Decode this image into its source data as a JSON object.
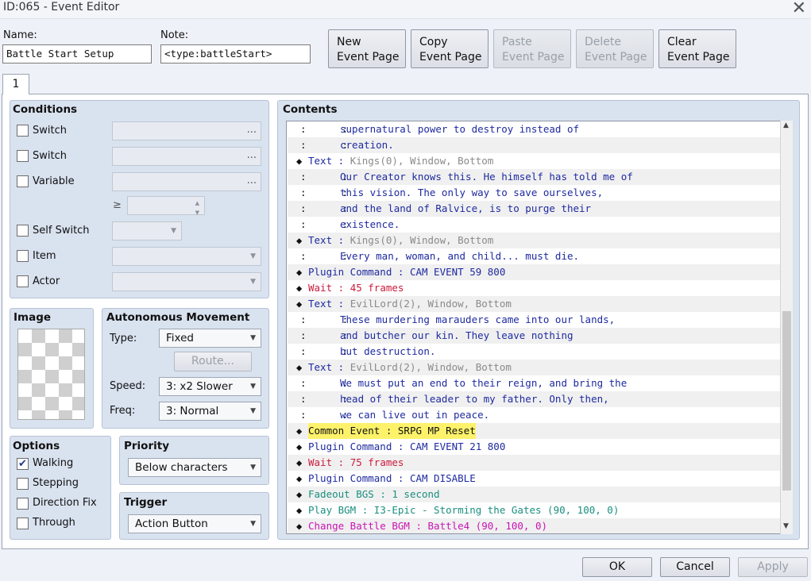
{
  "window": {
    "title": "ID:065 - Event Editor"
  },
  "name": {
    "label": "Name:",
    "value": "Battle Start Setup"
  },
  "note": {
    "label": "Note:",
    "value": "<type:battleStart>"
  },
  "page_buttons": [
    {
      "line1": "New",
      "line2": "Event Page",
      "enabled": true
    },
    {
      "line1": "Copy",
      "line2": "Event Page",
      "enabled": true
    },
    {
      "line1": "Paste",
      "line2": "Event Page",
      "enabled": false
    },
    {
      "line1": "Delete",
      "line2": "Event Page",
      "enabled": false
    },
    {
      "line1": "Clear",
      "line2": "Event Page",
      "enabled": true
    }
  ],
  "tab": {
    "label": "1"
  },
  "conditions": {
    "title": "Conditions",
    "switch1": "Switch",
    "switch2": "Switch",
    "variable": "Variable",
    "ellipsis": "...",
    "gte": "≥",
    "self_switch": "Self Switch",
    "item": "Item",
    "actor": "Actor"
  },
  "image": {
    "title": "Image"
  },
  "movement": {
    "title": "Autonomous Movement",
    "type_label": "Type:",
    "type_value": "Fixed",
    "route_label": "Route...",
    "speed_label": "Speed:",
    "speed_value": "3: x2 Slower",
    "freq_label": "Freq:",
    "freq_value": "3: Normal"
  },
  "options": {
    "title": "Options",
    "walking": "Walking",
    "walking_checked": "✔",
    "stepping": "Stepping",
    "direction_fix": "Direction Fix",
    "through": "Through"
  },
  "priority": {
    "title": "Priority",
    "value": "Below characters"
  },
  "trigger": {
    "title": "Trigger",
    "value": "Action Button"
  },
  "contents": {
    "title": "Contents",
    "rows": [
      {
        "kind": "cont",
        "text": "supernatural power to destroy instead of"
      },
      {
        "kind": "cont",
        "text": "creation."
      },
      {
        "kind": "cmd",
        "cls": "k-text",
        "name": "Text",
        "sep": " : ",
        "args": "Kings(0), Window, Bottom",
        "argcls": "gray"
      },
      {
        "kind": "cont",
        "text": "Our Creator knows this. He himself has told me of"
      },
      {
        "kind": "cont",
        "text": "this vision. The only way to save ourselves,"
      },
      {
        "kind": "cont",
        "text": "and the land of Ralvice, is to purge their"
      },
      {
        "kind": "cont",
        "text": "existence."
      },
      {
        "kind": "cmd",
        "cls": "k-text",
        "name": "Text",
        "sep": " : ",
        "args": "Kings(0), Window, Bottom",
        "argcls": "gray"
      },
      {
        "kind": "cont",
        "text": "Every man, woman, and child... must die."
      },
      {
        "kind": "cmd",
        "cls": "k-plugin",
        "name": "Plugin Command",
        "sep": " : ",
        "args": "CAM EVENT 59 800",
        "argcls": "k-plugin"
      },
      {
        "kind": "cmd",
        "cls": "k-wait",
        "name": "Wait",
        "sep": " : ",
        "args": "45 frames",
        "argcls": "k-wait"
      },
      {
        "kind": "cmd",
        "cls": "k-text",
        "name": "Text",
        "sep": " : ",
        "args": "EvilLord(2), Window, Bottom",
        "argcls": "gray"
      },
      {
        "kind": "cont",
        "text": "These murdering marauders came into our lands,"
      },
      {
        "kind": "cont",
        "text": "and butcher our kin. They leave nothing"
      },
      {
        "kind": "cont",
        "text": "but destruction."
      },
      {
        "kind": "cmd",
        "cls": "k-text",
        "name": "Text",
        "sep": " : ",
        "args": "EvilLord(2), Window, Bottom",
        "argcls": "gray"
      },
      {
        "kind": "cont",
        "text": "We must put an end to their reign, and bring the"
      },
      {
        "kind": "cont",
        "text": "head of their leader to my father. Only then,"
      },
      {
        "kind": "cont",
        "text": "we can live out in peace."
      },
      {
        "kind": "cmd",
        "cls": "k-common",
        "name": "Common Event",
        "sep": " : ",
        "args": "SRPG MP Reset",
        "argcls": "k-common",
        "highlight": true
      },
      {
        "kind": "cmd",
        "cls": "k-plugin",
        "name": "Plugin Command",
        "sep": " : ",
        "args": "CAM EVENT 21 800",
        "argcls": "k-plugin"
      },
      {
        "kind": "cmd",
        "cls": "k-wait",
        "name": "Wait",
        "sep": " : ",
        "args": "75 frames",
        "argcls": "k-wait"
      },
      {
        "kind": "cmd",
        "cls": "k-plugin",
        "name": "Plugin Command",
        "sep": " : ",
        "args": "CAM DISABLE",
        "argcls": "k-plugin"
      },
      {
        "kind": "cmd",
        "cls": "k-fade",
        "name": "Fadeout BGS",
        "sep": " : ",
        "args": "1 second",
        "argcls": "k-fade"
      },
      {
        "kind": "cmd",
        "cls": "k-bgm",
        "name": "Play BGM",
        "sep": " : ",
        "args": "I3-Epic - Storming the Gates (90, 100, 0)",
        "argcls": "k-bgm"
      },
      {
        "kind": "cmd",
        "cls": "k-battle",
        "name": "Change Battle BGM",
        "sep": " : ",
        "args": "Battle4 (90, 100, 0)",
        "argcls": "k-battle"
      }
    ]
  },
  "footer": {
    "ok": "OK",
    "cancel": "Cancel",
    "apply": "Apply"
  }
}
